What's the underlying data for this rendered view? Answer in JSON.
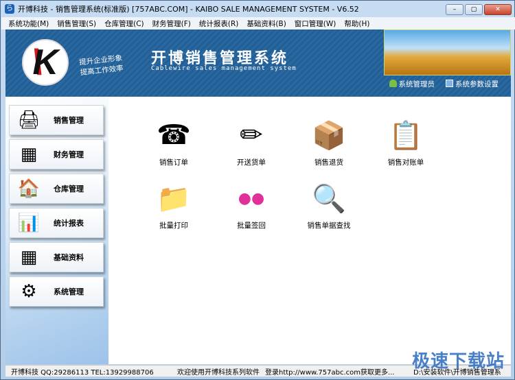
{
  "window": {
    "title": "开博科技 - 销售管理系统(标准版) [757ABC.COM] - KAIBO SALE MANAGEMENT SYSTEM - V6.52",
    "min": "–",
    "max": "▢",
    "close": "✕"
  },
  "menu": [
    "系统功能(M)",
    "销售管理(S)",
    "仓库管理(C)",
    "财务管理(F)",
    "统计报表(R)",
    "基础资料(B)",
    "窗口管理(W)",
    "帮助(H)"
  ],
  "banner": {
    "logo": "K",
    "slogan1": "提升企业形象",
    "slogan2": "提高工作效率",
    "title": "开博销售管理系统",
    "subtitle": "Cablewire sales management system",
    "link_admin": "系统管理员",
    "link_settings": "系统参数设置"
  },
  "sidebar": [
    {
      "label": "销售管理",
      "icon": "printer-icon",
      "glyph": "🖨"
    },
    {
      "label": "财务管理",
      "icon": "spreadsheet-icon",
      "glyph": "▦"
    },
    {
      "label": "仓库管理",
      "icon": "house-icon",
      "glyph": "🏠"
    },
    {
      "label": "统计报表",
      "icon": "bar-chart-icon",
      "glyph": "📊"
    },
    {
      "label": "基础资料",
      "icon": "table-icon",
      "glyph": "▦"
    },
    {
      "label": "系统管理",
      "icon": "gear-icon",
      "glyph": "⚙"
    }
  ],
  "items": [
    {
      "label": "销售订单",
      "icon": "telephone-icon",
      "glyph": "☎"
    },
    {
      "label": "开送货单",
      "icon": "pencil-icon",
      "glyph": "✏"
    },
    {
      "label": "销售退货",
      "icon": "return-box-icon",
      "glyph": "📦"
    },
    {
      "label": "销售对账单",
      "icon": "clipboard-chart-icon",
      "glyph": "📋"
    },
    {
      "label": "批量打印",
      "icon": "folders-icon",
      "glyph": "📁"
    },
    {
      "label": "批量签回",
      "icon": "flickr-dots-icon",
      "glyph": "●●"
    },
    {
      "label": "销售单据查找",
      "icon": "magnifier-icon",
      "glyph": "🔍"
    }
  ],
  "status": {
    "company": "开博科技 QQ:29286113 TEL:13929988706",
    "welcome": "欢迎使用开博科技系列软件",
    "login": "登录http://www.757abc.com获取更多...",
    "path": "D:\\安装软件\\开博销售管理系"
  },
  "watermark": "极速下载站"
}
